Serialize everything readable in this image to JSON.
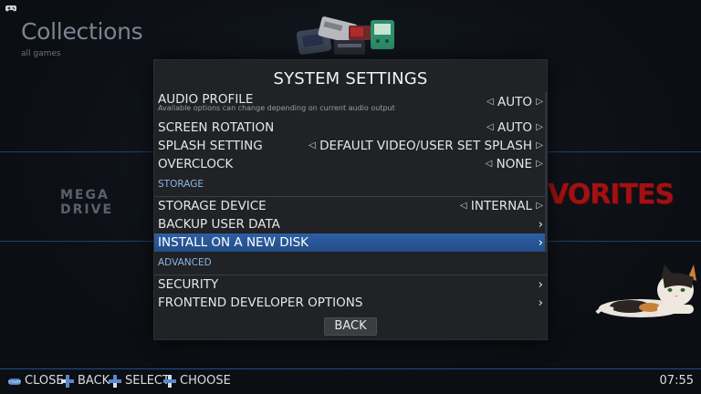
{
  "background": {
    "title": "Collections",
    "subtitle": "all games",
    "logo_left_text": "MEGA DRIVE",
    "logo_right_text": "VORITES"
  },
  "dialog": {
    "title": "SYSTEM SETTINGS",
    "rows": [
      {
        "label": "AUDIO PROFILE",
        "value": "AUTO",
        "hint": "Available options can change depending on current audio output"
      },
      {
        "label": "SCREEN ROTATION",
        "value": "AUTO"
      },
      {
        "label": "SPLASH SETTING",
        "value": "DEFAULT VIDEO/USER SET SPLASH"
      },
      {
        "label": "OVERCLOCK",
        "value": "NONE"
      }
    ],
    "section_storage": "STORAGE",
    "storage_rows": [
      {
        "label": "STORAGE DEVICE",
        "value": "INTERNAL"
      },
      {
        "label": "BACKUP USER DATA"
      },
      {
        "label": "INSTALL ON A NEW DISK"
      }
    ],
    "section_advanced": "ADVANCED",
    "advanced_rows": [
      {
        "label": "SECURITY"
      },
      {
        "label": "FRONTEND DEVELOPER OPTIONS"
      }
    ],
    "back_label": "BACK"
  },
  "footer": {
    "close": "CLOSE",
    "back": "BACK",
    "select": "SELECT",
    "choose": "CHOOSE",
    "clock": "07:55"
  },
  "icons": {
    "top_left": "gamepad-icon",
    "start": "start-button-icon",
    "dpad": "dpad-icon"
  },
  "colors": {
    "selection": "#2e5fa3",
    "section": "#8ab4ea",
    "dialog_bg": "#202225",
    "accent_line": "#1f4f86"
  }
}
